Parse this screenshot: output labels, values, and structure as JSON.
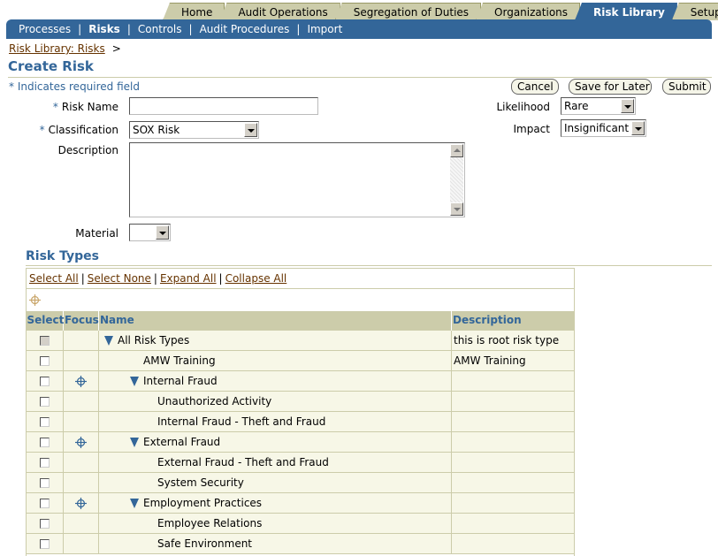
{
  "tabs": [
    {
      "label": "Home",
      "active": false
    },
    {
      "label": "Audit Operations",
      "active": false
    },
    {
      "label": "Segregation of Duties",
      "active": false
    },
    {
      "label": "Organizations",
      "active": false
    },
    {
      "label": "Risk Library",
      "active": true
    },
    {
      "label": "Setup",
      "active": false
    }
  ],
  "subnav": [
    {
      "label": "Processes",
      "active": false
    },
    {
      "label": "Risks",
      "active": true
    },
    {
      "label": "Controls",
      "active": false
    },
    {
      "label": "Audit Procedures",
      "active": false
    },
    {
      "label": "Import",
      "active": false
    }
  ],
  "breadcrumb": {
    "link": "Risk Library: Risks",
    "arrow": ">"
  },
  "page_title": "Create Risk",
  "required_note": "* Indicates required field",
  "buttons": {
    "cancel": "Cancel",
    "save_later": "Save for Later",
    "submit": "Submit"
  },
  "form": {
    "risk_name_label": "Risk Name",
    "risk_name_value": "",
    "classification_label": "Classification",
    "classification_value": "SOX Risk",
    "description_label": "Description",
    "description_value": "",
    "material_label": "Material",
    "material_value": "",
    "likelihood_label": "Likelihood",
    "likelihood_value": "Rare",
    "impact_label": "Impact",
    "impact_value": "Insignificant",
    "required_star": "*"
  },
  "risk_types": {
    "title": "Risk Types",
    "links": {
      "select_all": "Select All",
      "select_none": "Select None",
      "expand_all": "Expand All",
      "collapse_all": "Collapse All"
    },
    "columns": {
      "select": "Select",
      "focus": "Focus",
      "name": "Name",
      "description": "Description"
    },
    "rows": [
      {
        "name": "All Risk Types",
        "description": "this is root risk type",
        "level": 0,
        "expanded": true,
        "focus": false,
        "disabled": true
      },
      {
        "name": "AMW Training",
        "description": "AMW Training",
        "level": 1,
        "expanded": false,
        "focus": false,
        "disabled": false
      },
      {
        "name": "Internal Fraud",
        "description": "",
        "level": 1,
        "expanded": true,
        "focus": true,
        "disabled": false
      },
      {
        "name": "Unauthorized Activity",
        "description": "",
        "level": 2,
        "expanded": false,
        "focus": false,
        "disabled": false
      },
      {
        "name": "Internal Fraud - Theft and Fraud",
        "description": "",
        "level": 2,
        "expanded": false,
        "focus": false,
        "disabled": false
      },
      {
        "name": "External Fraud",
        "description": "",
        "level": 1,
        "expanded": true,
        "focus": true,
        "disabled": false
      },
      {
        "name": "External Fraud - Theft and Fraud",
        "description": "",
        "level": 2,
        "expanded": false,
        "focus": false,
        "disabled": false
      },
      {
        "name": "System Security",
        "description": "",
        "level": 2,
        "expanded": false,
        "focus": false,
        "disabled": false
      },
      {
        "name": "Employment Practices",
        "description": "",
        "level": 1,
        "expanded": true,
        "focus": true,
        "disabled": false
      },
      {
        "name": "Employee Relations",
        "description": "",
        "level": 2,
        "expanded": false,
        "focus": false,
        "disabled": false
      },
      {
        "name": "Safe Environment",
        "description": "",
        "level": 2,
        "expanded": false,
        "focus": false,
        "disabled": false
      }
    ]
  },
  "colors": {
    "brand": "#336699",
    "tab_bg": "#ccccaa",
    "link": "#663300",
    "row_bg": "#f7f7e7"
  }
}
